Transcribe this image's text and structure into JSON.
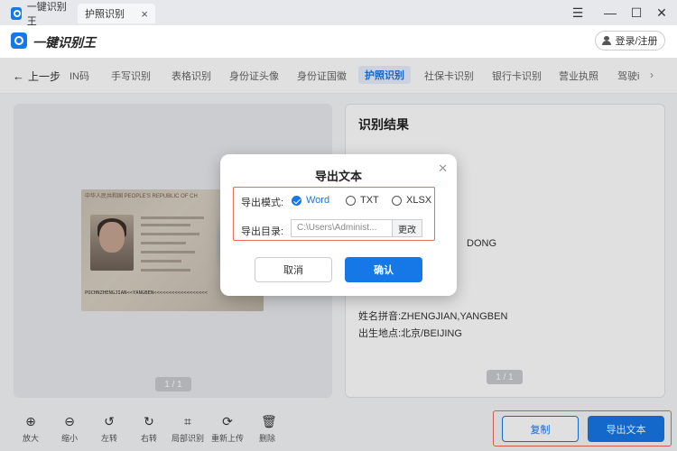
{
  "window": {
    "tabs": [
      {
        "label": "一键识别王"
      },
      {
        "label": "护照识别"
      }
    ],
    "controls": {
      "menu": "☰",
      "minimize": "—",
      "maximize": "☐",
      "close": "✕"
    }
  },
  "header": {
    "app_title": "一键识别王",
    "login_label": "登录/注册"
  },
  "nav": {
    "back_label": "上一步",
    "items": [
      {
        "label": "IN码"
      },
      {
        "label": "手写识别"
      },
      {
        "label": "表格识别"
      },
      {
        "label": "身份证头像"
      },
      {
        "label": "身份证国徽"
      },
      {
        "label": "护照识别"
      },
      {
        "label": "社保卡识别"
      },
      {
        "label": "银行卡识别"
      },
      {
        "label": "营业执照"
      },
      {
        "label": "驾驶i"
      }
    ],
    "active": "护照识别"
  },
  "preview": {
    "pager": "1 / 1",
    "passport": {
      "header_text": "中华人民共和国  PEOPLE'S REPUBLIC OF CH",
      "mrz": "POCHNZHENGJIAN<<YANGBEN<<<<<<<<<<<<<<<<<<"
    }
  },
  "result": {
    "title": "识别结果",
    "lines": [
      "DONG",
      "姓名拼音:ZHENGJIAN,YANGBEN",
      "出生地点:北京/BEIJING"
    ],
    "pager": "1 / 1"
  },
  "modal": {
    "title": "导出文本",
    "mode_label": "导出模式:",
    "options": [
      "Word",
      "TXT",
      "XLSX"
    ],
    "selected": "Word",
    "dir_label": "导出目录:",
    "dir_value": "C:\\Users\\Administ...",
    "change_label": "更改",
    "cancel_label": "取消",
    "confirm_label": "确认"
  },
  "toolbar": {
    "tools": [
      {
        "label": "放大",
        "icon": "zoom-in-icon"
      },
      {
        "label": "缩小",
        "icon": "zoom-out-icon"
      },
      {
        "label": "左转",
        "icon": "rotate-left-icon"
      },
      {
        "label": "右转",
        "icon": "rotate-right-icon"
      },
      {
        "label": "局部识别",
        "icon": "crop-scan-icon"
      },
      {
        "label": "重新上传",
        "icon": "refresh-icon"
      },
      {
        "label": "删除",
        "icon": "trash-icon"
      }
    ],
    "copy_label": "复制",
    "export_label": "导出文本"
  },
  "colors": {
    "accent": "#1677e6",
    "highlight_box": "#e86a5a"
  }
}
